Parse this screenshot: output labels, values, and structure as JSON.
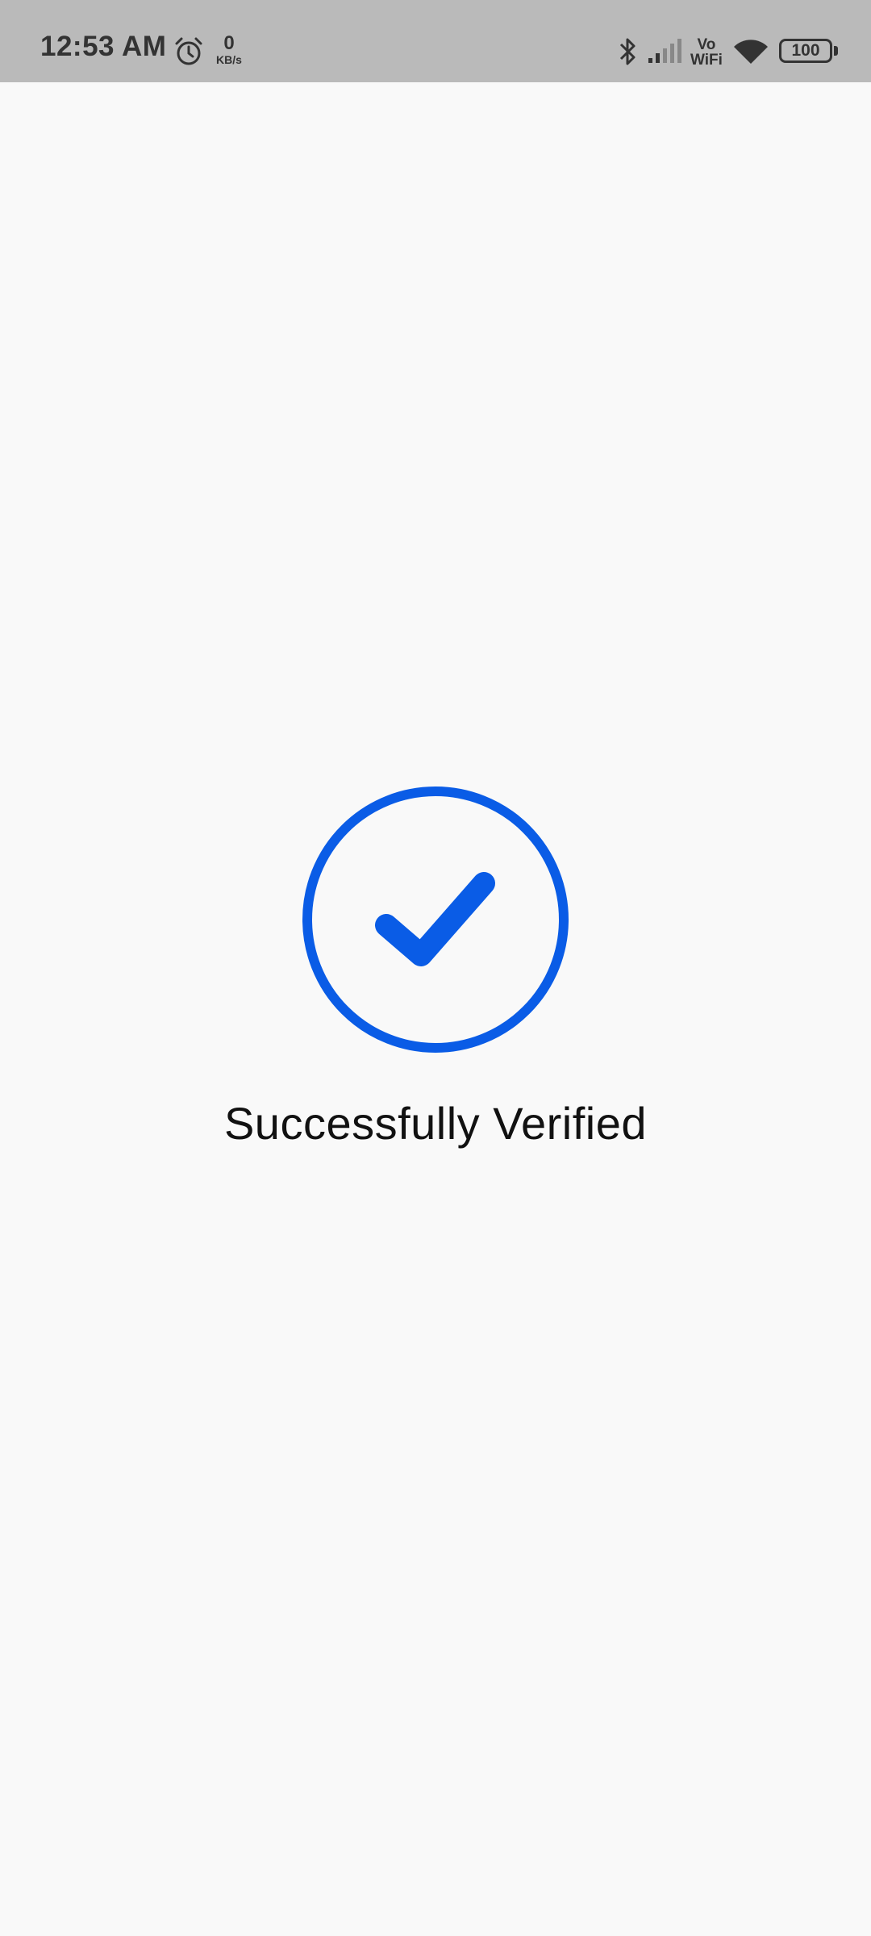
{
  "status_bar": {
    "time": "12:53 AM",
    "net_speed_value": "0",
    "net_speed_unit": "KB/s",
    "vowifi_top": "Vo",
    "vowifi_bottom": "WiFi",
    "battery_level": "100",
    "icons": [
      "alarm-icon",
      "bluetooth-icon",
      "signal-icon",
      "wifi-icon",
      "battery-icon"
    ]
  },
  "main": {
    "badge_icon": "checkmark-circle-icon",
    "message": "Successfully Verified",
    "accent_color": "#0a5ce6"
  }
}
